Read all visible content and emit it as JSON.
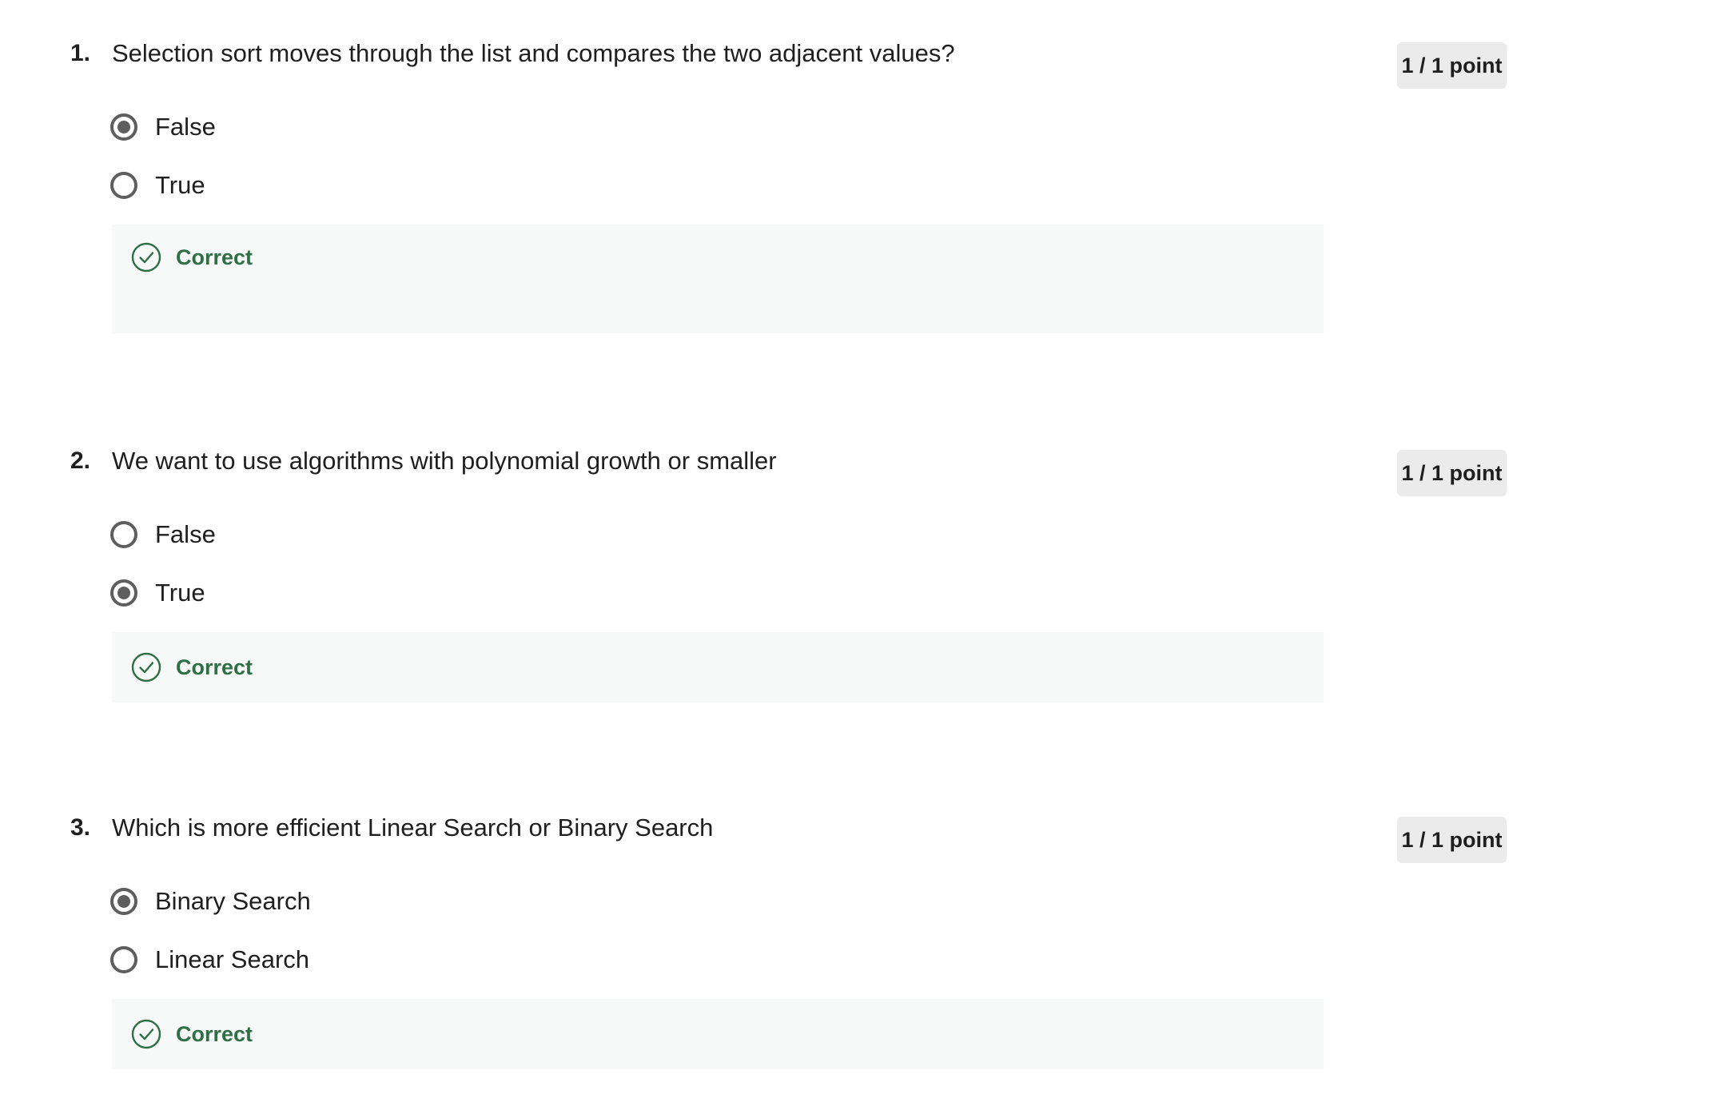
{
  "questions": [
    {
      "number": "1.",
      "text": "Selection sort moves through the list and compares the two adjacent values?",
      "points": "1 / 1 point",
      "options": [
        {
          "label": "False",
          "selected": true
        },
        {
          "label": "True",
          "selected": false
        }
      ],
      "feedback": "Correct"
    },
    {
      "number": "2.",
      "text": "We want to use algorithms with polynomial growth or smaller",
      "points": "1 / 1 point",
      "options": [
        {
          "label": "False",
          "selected": false
        },
        {
          "label": "True",
          "selected": true
        }
      ],
      "feedback": "Correct"
    },
    {
      "number": "3.",
      "text": "Which is more efficient Linear Search or Binary Search",
      "points": "1 / 1 point",
      "options": [
        {
          "label": "Binary Search",
          "selected": true
        },
        {
          "label": "Linear Search",
          "selected": false
        }
      ],
      "feedback": "Correct"
    }
  ],
  "colors": {
    "correct": "#2e6f45",
    "radio": "#5e5e5e",
    "badge_bg": "#ebebeb",
    "feedback_bg": "#f7f9f8"
  },
  "icons": {
    "radio_selected": "radio-selected-icon",
    "radio_unselected": "radio-unselected-icon",
    "feedback": "check-circle-icon"
  }
}
